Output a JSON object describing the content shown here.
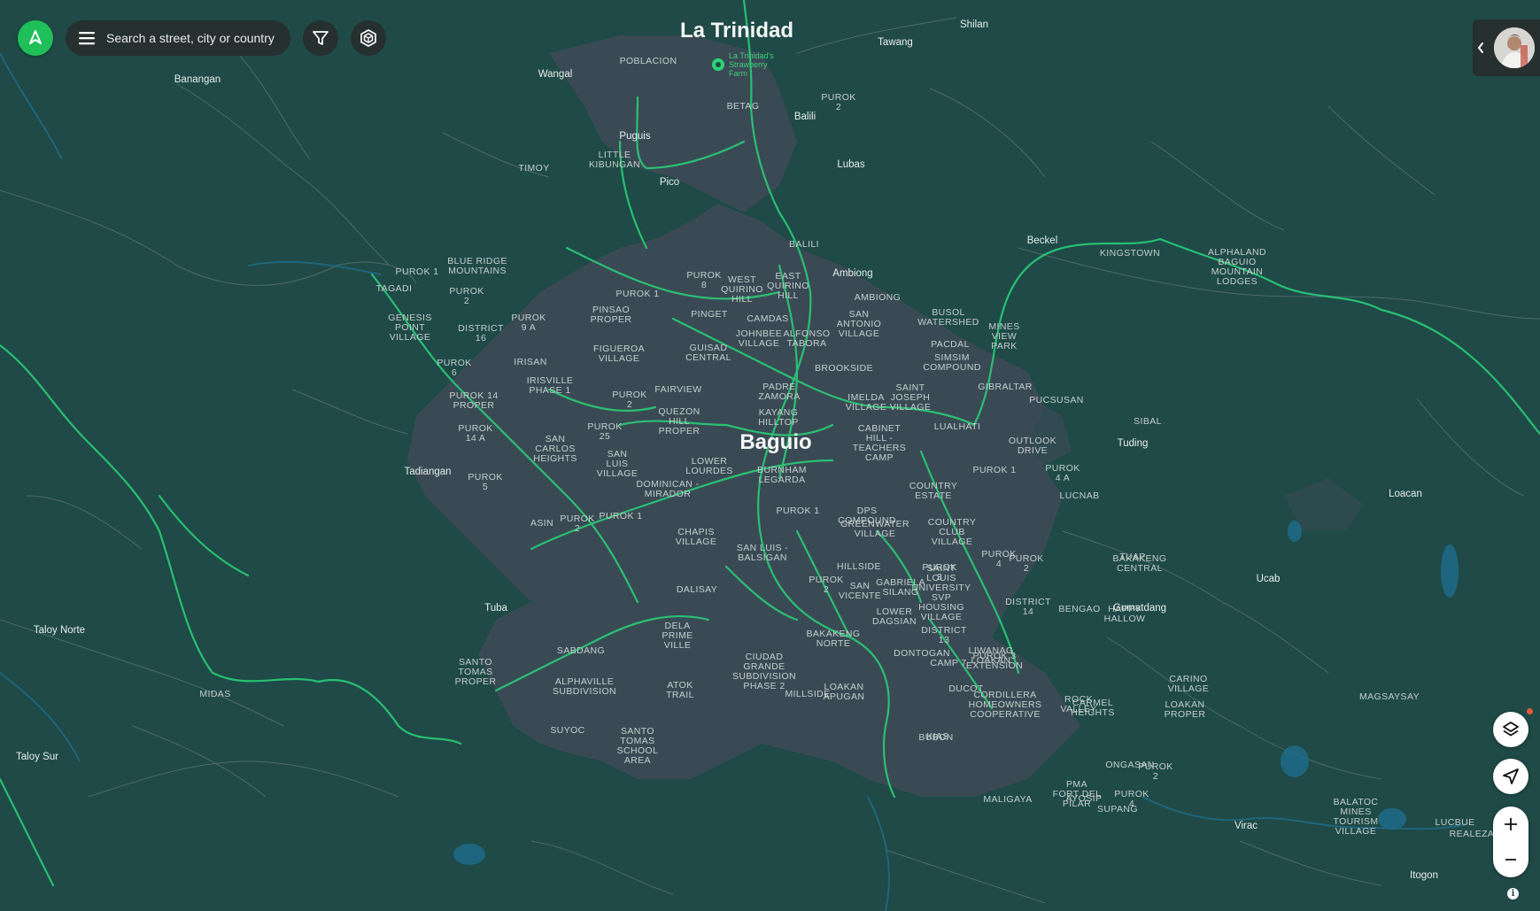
{
  "search": {
    "placeholder": "Search a street, city or country"
  },
  "info_label": "i",
  "map": {
    "cities": [
      {
        "name": "La Trinidad"
      },
      {
        "name": "Baguio"
      }
    ],
    "places": [
      "Shilan",
      "Tawang",
      "Wangal",
      "Banangan",
      "Balili",
      "Lubas",
      "Puguis",
      "Pico",
      "Beckel",
      "Ambiong",
      "Tadiangan",
      "Tuba",
      "Tuding",
      "Loacan",
      "Ucab",
      "Gumatdang",
      "Virac",
      "Itogon",
      "Taloy Norte",
      "Taloy Sur"
    ],
    "neighborhoods": [
      [
        "POBLACION"
      ],
      [
        "BETAG"
      ],
      [
        "PUROK",
        "2"
      ],
      [
        "LITTLE",
        "KIBUNGAN"
      ],
      [
        "TIMOY"
      ],
      [
        "BALILI"
      ],
      [
        "KINGSTOWN"
      ],
      [
        "ALPHALAND",
        "BAGUIO",
        "MOUNTAIN",
        "LODGES"
      ],
      [
        "BLUE RIDGE",
        "MOUNTAINS"
      ],
      [
        "PUROK 1"
      ],
      [
        "TAGADI"
      ],
      [
        "PUROK",
        "2"
      ],
      [
        "GENESIS",
        "POINT",
        "VILLAGE"
      ],
      [
        "DISTRICT",
        "16"
      ],
      [
        "PUROK",
        "9 A"
      ],
      [
        "PINSAO",
        "PROPER"
      ],
      [
        "PUROK 1"
      ],
      [
        "PUROK",
        "8"
      ],
      [
        "WEST",
        "QUIRINO",
        "HILL"
      ],
      [
        "EAST",
        "QUIRINO",
        "HILL"
      ],
      [
        "AMBIONG"
      ],
      [
        "PINGET"
      ],
      [
        "CAMDAS"
      ],
      [
        "SAN",
        "ANTONIO",
        "VILLAGE"
      ],
      [
        "BUSOL",
        "WATERSHED"
      ],
      [
        "MINES",
        "VIEW",
        "PARK"
      ],
      [
        "IRISAN"
      ],
      [
        "FIGUEROA",
        "VILLAGE"
      ],
      [
        "GUISAD",
        "CENTRAL"
      ],
      [
        "JOHNBEE",
        "VILLAGE"
      ],
      [
        "ALFONSO",
        "TABORA"
      ],
      [
        "PACDAL"
      ],
      [
        "SIMSIM",
        "COMPOUND"
      ],
      [
        "PUROK",
        "6"
      ],
      [
        "IRISVILLE",
        "PHASE 1"
      ],
      [
        "BROOKSIDE"
      ],
      [
        "PUROK 14",
        "PROPER"
      ],
      [
        "PUROK",
        "2"
      ],
      [
        "FAIRVIEW"
      ],
      [
        "PADRE",
        "ZAMORA"
      ],
      [
        "IMELDA",
        "VILLAGE"
      ],
      [
        "SAINT",
        "JOSEPH",
        "VILLAGE"
      ],
      [
        "GIBRALTAR"
      ],
      [
        "PUCSUSAN"
      ],
      [
        "SIBAL"
      ],
      [
        "PUROK",
        "14 A"
      ],
      [
        "QUEZON",
        "HILL",
        "PROPER"
      ],
      [
        "KAYANG",
        "HILLTOP"
      ],
      [
        "LUALHATI"
      ],
      [
        "SAN",
        "CARLOS",
        "HEIGHTS"
      ],
      [
        "PUROK",
        "25"
      ],
      [
        "CABINET",
        "HILL -",
        "TEACHERS",
        "CAMP"
      ],
      [
        "OUTLOOK",
        "DRIVE"
      ],
      [
        "SAN",
        "LUIS",
        "VILLAGE"
      ],
      [
        "LOWER",
        "LOURDES"
      ],
      [
        "PUROK 1"
      ],
      [
        "PUROK",
        "4 A"
      ],
      [
        "PUROK",
        "5"
      ],
      [
        "BURNHAM",
        "LEGARDA"
      ],
      [
        "COUNTRY",
        "ESTATE"
      ],
      [
        "DOMINICAN -",
        "MIRADOR"
      ],
      [
        "LUCNAB"
      ],
      [
        "DPS",
        "COMPOUND"
      ],
      [
        "PUROK 1"
      ],
      [
        "ASIN"
      ],
      [
        "PUROK",
        "2"
      ],
      [
        "PUROK 1"
      ],
      [
        "GREENWATER",
        "VILLAGE"
      ],
      [
        "COUNTRY",
        "CLUB",
        "VILLAGE"
      ],
      [
        "CHAPIS",
        "VILLAGE"
      ],
      [
        "SAN LUIS -",
        "BALSIGAN"
      ],
      [
        "PUROK",
        "4"
      ],
      [
        "TUAP"
      ],
      [
        "HILLSIDE"
      ],
      [
        "GABRIELA",
        "SILANG"
      ],
      [
        "PUROK",
        "2"
      ],
      [
        "BAKAKENG",
        "CENTRAL"
      ],
      [
        "SAN",
        "VICENTE"
      ],
      [
        "SAINT",
        "LOUIS",
        "UNIVERSITY",
        "SVP",
        "HOUSING",
        "VILLAGE"
      ],
      [
        "PUROK",
        "2"
      ],
      [
        "DALISAY"
      ],
      [
        "PUROK",
        "3"
      ],
      [
        "HAPPY",
        "HALLOW"
      ],
      [
        "LOWER",
        "DAGSIAN"
      ],
      [
        "BENGAO"
      ],
      [
        "DISTRICT",
        "13"
      ],
      [
        "DISTRICT",
        "14"
      ],
      [
        "LIWANAG",
        "LOAKAN"
      ],
      [
        "PUROK 3",
        "EXTENSION"
      ],
      [
        "DELA",
        "PRIME",
        "VILLE"
      ],
      [
        "BAKAKENG",
        "NORTE"
      ],
      [
        "SABDANG"
      ],
      [
        "DONTOGAN"
      ],
      [
        "CAMP 7"
      ],
      [
        "SANTO",
        "TOMAS",
        "PROPER"
      ],
      [
        "CIUDAD",
        "GRANDE",
        "SUBDIVISION",
        "PHASE 2"
      ],
      [
        "CARINO",
        "VILLAGE"
      ],
      [
        "ALPHAVILLE",
        "SUBDIVISION"
      ],
      [
        "LOAKAN",
        "APUGAN"
      ],
      [
        "ATOK",
        "TRAIL"
      ],
      [
        "MILLSIDE"
      ],
      [
        "DUCOT"
      ],
      [
        "CORDILLERA",
        "HOMEOWNERS",
        "COOPERATIVE"
      ],
      [
        "CARMEL",
        "HEIGHTS"
      ],
      [
        "ROCK",
        "VALLEY"
      ],
      [
        "LOAKAN",
        "PROPER"
      ],
      [
        "MAGSAYSAY"
      ],
      [
        "MIDAS"
      ],
      [
        "SUYOC"
      ],
      [
        "SANTO",
        "TOMAS",
        "SCHOOL",
        "AREA"
      ],
      [
        "KIAS"
      ],
      [
        "BUBON"
      ],
      [
        "ONGASAN"
      ],
      [
        "PUROK",
        "2"
      ],
      [
        "PMA",
        "FORT DEL",
        "PILAR"
      ],
      [
        "PUROK",
        "4"
      ],
      [
        "MALIGAYA"
      ],
      [
        "AYOSIP"
      ],
      [
        "SUPANG"
      ],
      [
        "BALATOC",
        "MINES",
        "TOURISM",
        "VILLAGE"
      ],
      [
        "LUCBUE"
      ],
      [
        "REALEZA"
      ]
    ],
    "pois": [
      {
        "name": [
          "La Trinidad's",
          "Strawberry",
          "Farm"
        ]
      }
    ]
  },
  "icons": {
    "logo": "compass-arrow-icon",
    "menu": "menu-icon",
    "filter": "filter-icon",
    "heatmap": "layers-hex-icon",
    "collapse": "chevron-left-icon",
    "layers": "stack-layers-icon",
    "locate": "navigation-arrow-icon",
    "zoom_in": "plus-icon",
    "zoom_out": "minus-icon"
  },
  "colors": {
    "map_bg": "#1f4a47",
    "urban": "#3d4a57",
    "route": "#2ad47a",
    "accent": "#1fbf5a",
    "water": "#1f6b8a"
  }
}
